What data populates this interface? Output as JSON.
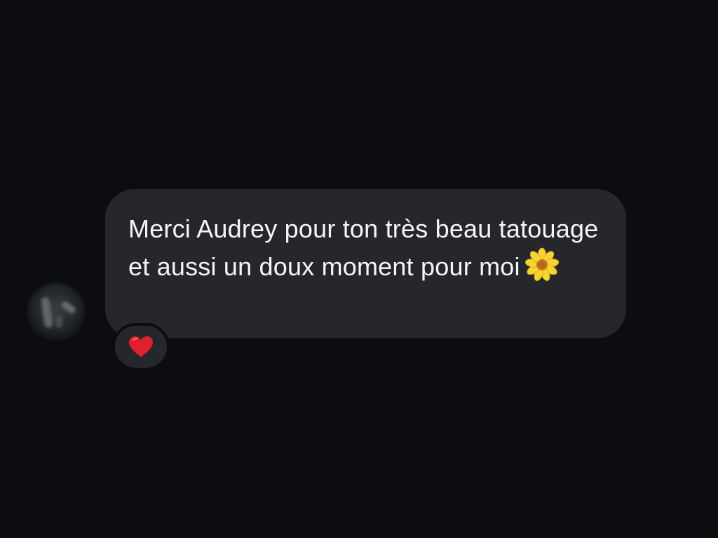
{
  "conversation": {
    "message": {
      "sender_avatar": "blurred-profile-photo",
      "text": "Merci Audrey pour ton très beau tatouage et aussi un doux moment pour moi",
      "trailing_icon": "sunflower-icon",
      "reaction": {
        "icon": "red-heart-icon",
        "color": "#e0202b"
      }
    }
  },
  "colors": {
    "background": "#0b0d11",
    "bubble": "#25272c",
    "text": "#f5f5f7",
    "flower_petals": "#f7d531",
    "flower_center": "#c8761c"
  }
}
